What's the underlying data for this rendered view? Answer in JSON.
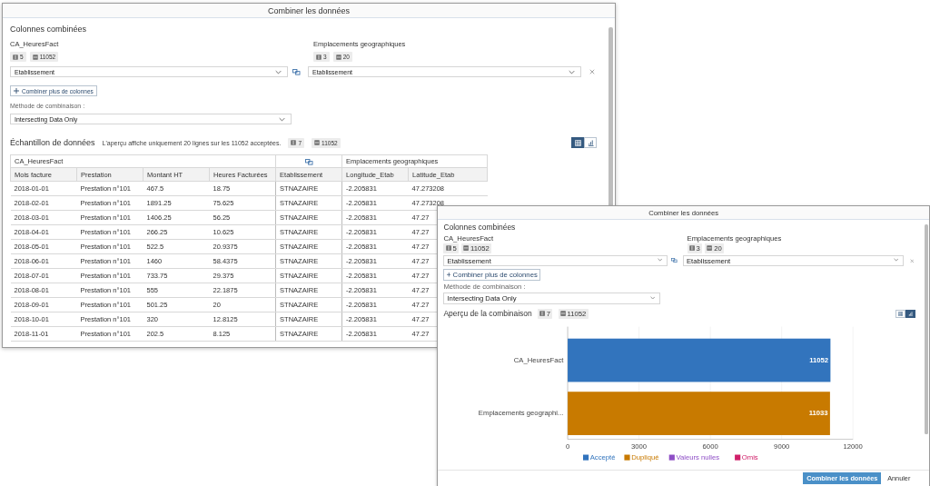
{
  "dialogs": [
    {
      "title": "Combiner les données",
      "section_title": "Colonnes combinées",
      "sources": [
        {
          "name": "CA_HeuresFact",
          "columns": "5",
          "rows": "11052",
          "key": "Etablissement"
        },
        {
          "name": "Emplacements geographiques",
          "columns": "3",
          "rows": "20",
          "key": "Etablissement"
        }
      ],
      "add_button": "Combiner plus de colonnes",
      "method_label": "Méthode de combinaison :",
      "method": "Intersecting Data Only",
      "preview": {
        "kind": "table",
        "title": "Échantillon de données",
        "note": "L'aperçu affiche uniquement 20 lignes sur les 11052 acceptées.",
        "columns": "7",
        "rows": "11052",
        "view_toggle": [
          {
            "kind": "table",
            "selected": true
          },
          {
            "kind": "chart",
            "selected": false
          }
        ],
        "table": {
          "groups": [
            {
              "kind": "source",
              "label": "CA_HeuresFact"
            },
            {
              "kind": "link"
            },
            {
              "kind": "source",
              "label": "Emplacements geographiques"
            }
          ],
          "columns": [
            "Mois facture",
            "Prestation",
            "Montant HT",
            "Heures Facturées",
            "Etablissement",
            "Longitude_Etab",
            "Latitude_Etab"
          ],
          "rows": [
            [
              "2018-01-01",
              "Prestation n°101",
              "467.5",
              "18.75",
              "STNAZAIRE",
              "-2.205831",
              "47.273208"
            ],
            [
              "2018-02-01",
              "Prestation n°101",
              "1891.25",
              "75.625",
              "STNAZAIRE",
              "-2.205831",
              "47.273208"
            ],
            [
              "2018-03-01",
              "Prestation n°101",
              "1406.25",
              "56.25",
              "STNAZAIRE",
              "-2.205831",
              "47.27"
            ],
            [
              "2018-04-01",
              "Prestation n°101",
              "266.25",
              "10.625",
              "STNAZAIRE",
              "-2.205831",
              "47.27"
            ],
            [
              "2018-05-01",
              "Prestation n°101",
              "522.5",
              "20.9375",
              "STNAZAIRE",
              "-2.205831",
              "47.27"
            ],
            [
              "2018-06-01",
              "Prestation n°101",
              "1460",
              "58.4375",
              "STNAZAIRE",
              "-2.205831",
              "47.27"
            ],
            [
              "2018-07-01",
              "Prestation n°101",
              "733.75",
              "29.375",
              "STNAZAIRE",
              "-2.205831",
              "47.27"
            ],
            [
              "2018-08-01",
              "Prestation n°101",
              "555",
              "22.1875",
              "STNAZAIRE",
              "-2.205831",
              "47.27"
            ],
            [
              "2018-09-01",
              "Prestation n°101",
              "501.25",
              "20",
              "STNAZAIRE",
              "-2.205831",
              "47.27"
            ],
            [
              "2018-10-01",
              "Prestation n°101",
              "320",
              "12.8125",
              "STNAZAIRE",
              "-2.205831",
              "47.27"
            ],
            [
              "2018-11-01",
              "Prestation n°101",
              "202.5",
              "8.125",
              "STNAZAIRE",
              "-2.205831",
              "47.27"
            ]
          ]
        }
      }
    },
    {
      "title": "Combiner les données",
      "section_title": "Colonnes combinées",
      "sources": [
        {
          "name": "CA_HeuresFact",
          "columns": "5",
          "rows": "11052",
          "key": "Etablissement"
        },
        {
          "name": "Emplacements geographiques",
          "columns": "3",
          "rows": "20",
          "key": "Etablissement"
        }
      ],
      "add_button": "Combiner plus de colonnes",
      "method_label": "Méthode de combinaison :",
      "method": "Intersecting Data Only",
      "preview": {
        "kind": "chart",
        "title": "Aperçu de la combinaison",
        "columns": "7",
        "rows": "11052",
        "view_toggle": [
          {
            "kind": "table",
            "selected": false
          },
          {
            "kind": "chart",
            "selected": true
          }
        ],
        "chart_data": {
          "type": "bar",
          "orientation": "horizontal",
          "data_labels": true,
          "grid": true,
          "legend": true,
          "categories": [
            "CA_HeuresFact",
            "Emplacements geographi..."
          ],
          "series": [
            {
              "name": "Accepté",
              "color": "#3274bd",
              "values": [
                11052,
                null
              ]
            },
            {
              "name": "Dupliqué",
              "color": "#c87a00",
              "values": [
                null,
                11033
              ]
            },
            {
              "name": "Valeurs nulles",
              "color": "#8e4ec6",
              "values": [
                null,
                null
              ]
            },
            {
              "name": "Omis",
              "color": "#d0206a",
              "values": [
                null,
                null
              ]
            }
          ],
          "xlim": [
            0,
            12000
          ],
          "xticks": [
            0,
            3000,
            6000,
            9000,
            12000
          ]
        }
      },
      "footer": [
        "Combiner les données",
        "Annuler"
      ]
    }
  ]
}
